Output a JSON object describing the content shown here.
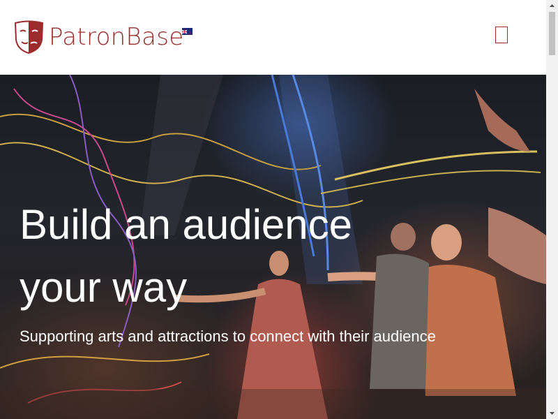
{
  "brand": {
    "name": "PatronBase",
    "color": "#9b2c2c"
  },
  "header": {
    "locale_flag": "nz-flag-icon",
    "menu_icon": "menu-icon"
  },
  "hero": {
    "title_line1": "Build an audience",
    "title_line2": "your way",
    "subtitle": "Supporting arts and attractions to connect with their audience"
  }
}
